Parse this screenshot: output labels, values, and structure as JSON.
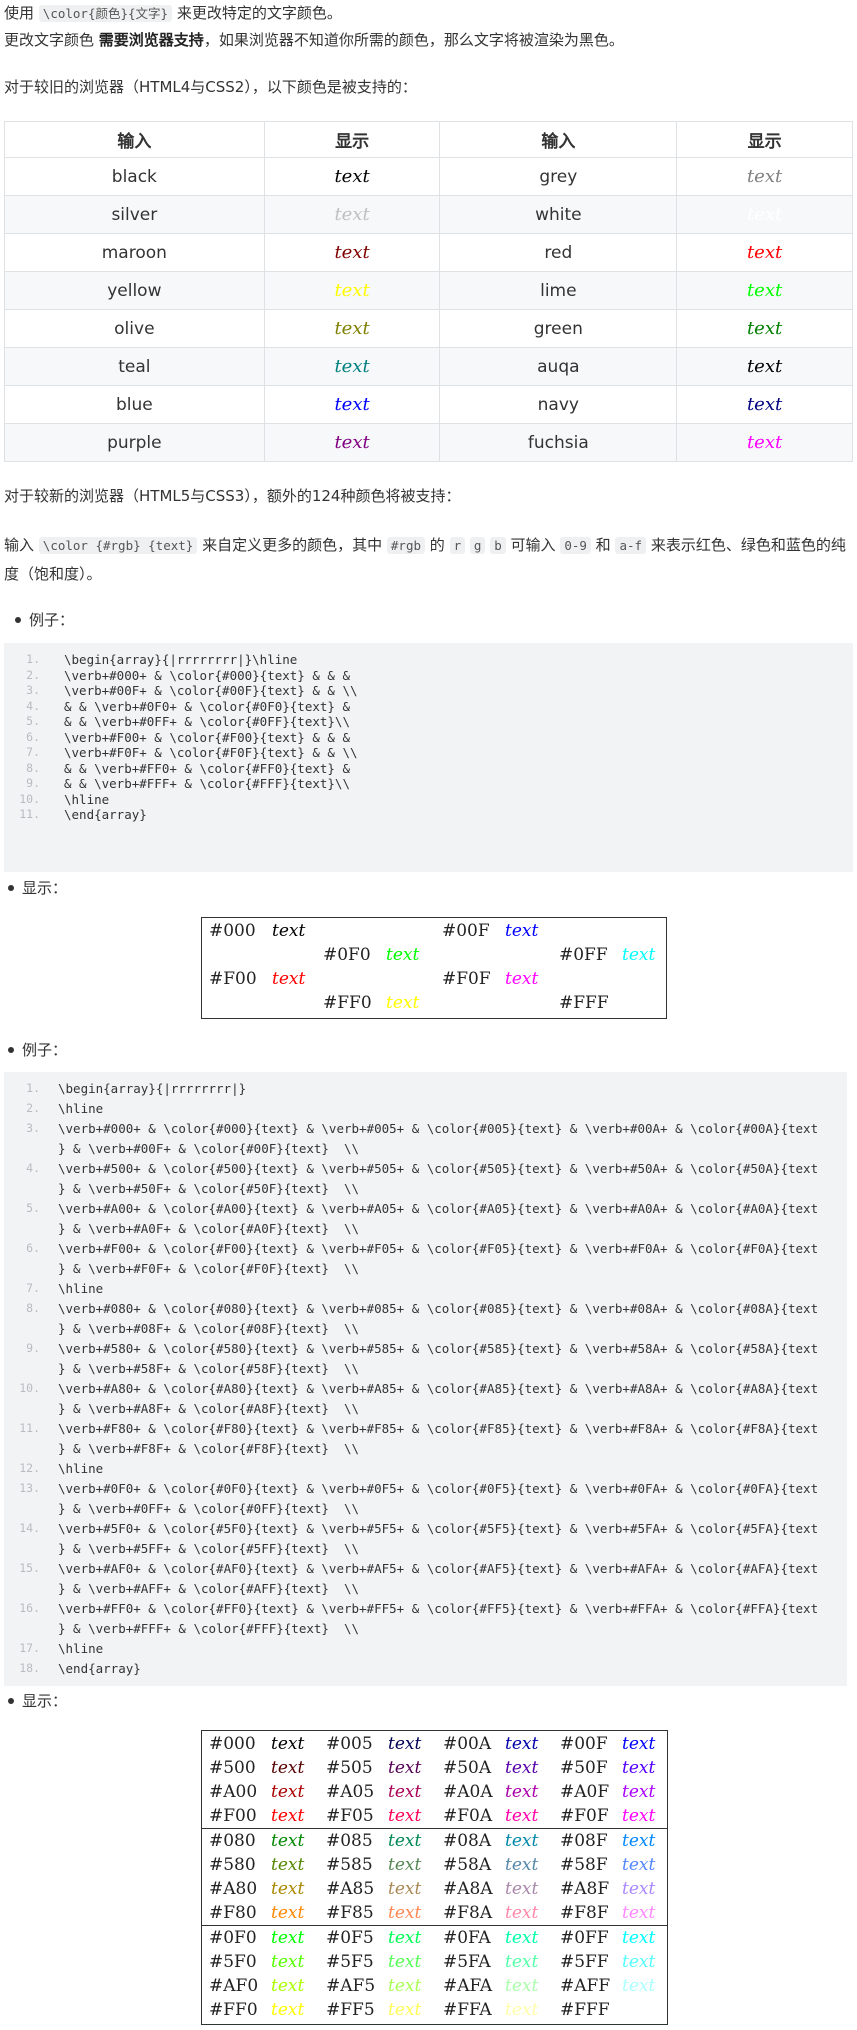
{
  "intro": {
    "line1_pre": "使用",
    "line1_code": "\\color{颜色}{文字}",
    "line1_post": "来更改特定的文字颜色。",
    "line2_pre": "更改文字颜色",
    "line2_bold": "需要浏览器支持",
    "line2_post": "，如果浏览器不知道你所需的颜色，那么文字将被渲染为黑色。",
    "line3": "对于较旧的浏览器（HTML4与CSS2），以下颜色是被支持的："
  },
  "color_table": {
    "headers": [
      "输入",
      "显示",
      "输入",
      "显示"
    ],
    "sample_text": "text",
    "rows": [
      [
        {
          "name": "black",
          "color": "#000000"
        },
        {
          "name": "grey",
          "color": "#808080"
        }
      ],
      [
        {
          "name": "silver",
          "color": "#c0c0c0"
        },
        {
          "name": "white",
          "color": "#ffffff"
        }
      ],
      [
        {
          "name": "maroon",
          "color": "#800000"
        },
        {
          "name": "red",
          "color": "#ff0000"
        }
      ],
      [
        {
          "name": "yellow",
          "color": "#ffff00"
        },
        {
          "name": "lime",
          "color": "#00ff00"
        }
      ],
      [
        {
          "name": "olive",
          "color": "#808000"
        },
        {
          "name": "green",
          "color": "#008000"
        }
      ],
      [
        {
          "name": "teal",
          "color": "#008080"
        },
        {
          "name": "auqa",
          "color": "#000000"
        }
      ],
      [
        {
          "name": "blue",
          "color": "#0000ff"
        },
        {
          "name": "navy",
          "color": "#000080"
        }
      ],
      [
        {
          "name": "purple",
          "color": "#800080"
        },
        {
          "name": "fuchsia",
          "color": "#ff00ff"
        }
      ]
    ]
  },
  "newer": {
    "line1": "对于较新的浏览器（HTML5与CSS3），额外的124种颜色将被支持：",
    "line2_pre": "输入",
    "line2_code1": "\\color {#rgb} {text}",
    "line2_mid1": "来自定义更多的颜色，其中",
    "line2_code2": "#rgb",
    "line2_mid2": "的",
    "code_r": "r",
    "code_g": "g",
    "code_b": "b",
    "line2_mid3": "可输入",
    "code_09": "0-9",
    "line2_and": "和",
    "code_af": "a-f",
    "line2_post": "来表示红色、绿色和蓝色的纯度（饱和度）。"
  },
  "bullets": {
    "example1": "例子：",
    "display1": "显示：",
    "example2": "例子：",
    "display2": "显示："
  },
  "code1": {
    "line_numbers": [
      "1.",
      "2.",
      "3.",
      "4.",
      "5.",
      "6.",
      "7.",
      "8.",
      "9.",
      "10.",
      "11."
    ],
    "lines": [
      "\\begin{array}{|rrrrrrrr|}\\hline",
      "\\verb+#000+ & \\color{#000}{text} & & &",
      "\\verb+#00F+ & \\color{#00F}{text} & & \\\\",
      "& & \\verb+#0F0+ & \\color{#0F0}{text} &",
      "& & \\verb+#0FF+ & \\color{#0FF}{text}\\\\",
      "\\verb+#F00+ & \\color{#F00}{text} & & &",
      "\\verb+#F0F+ & \\color{#F0F}{text} & & \\\\",
      "& & \\verb+#FF0+ & \\color{#FF0}{text} &",
      "& & \\verb+#FFF+ & \\color{#FFF}{text}\\\\",
      "\\hline",
      "\\end{array}"
    ]
  },
  "array1": {
    "sample_text": "text",
    "entries": [
      {
        "code": "#000",
        "color": "#000000",
        "row": 0,
        "col": 0
      },
      {
        "code": "#00F",
        "color": "#0000ff",
        "row": 0,
        "col": 2
      },
      {
        "code": "#0F0",
        "color": "#00ff00",
        "row": 1,
        "col": 1
      },
      {
        "code": "#0FF",
        "color": "#00ffff",
        "row": 1,
        "col": 3
      },
      {
        "code": "#F00",
        "color": "#ff0000",
        "row": 2,
        "col": 0
      },
      {
        "code": "#F0F",
        "color": "#ff00ff",
        "row": 2,
        "col": 2
      },
      {
        "code": "#FF0",
        "color": "#ffff00",
        "row": 3,
        "col": 1
      },
      {
        "code": "#FFF",
        "color": "#ffffff",
        "row": 3,
        "col": 3
      }
    ]
  },
  "code2": {
    "line_numbers": [
      "1.",
      "2.",
      "3.",
      "4.",
      "5.",
      "6.",
      "7.",
      "8.",
      "9.",
      "10.",
      "11.",
      "12.",
      "13.",
      "14.",
      "15.",
      "16.",
      "17.",
      "18."
    ],
    "lines": [
      [
        "\\begin{array}{|rrrrrrrr|}"
      ],
      [
        "\\hline"
      ],
      [
        "\\verb+#000+ & \\color{#000}{text} & \\verb+#005+ & \\color{#005}{text} & \\verb+#00A+ & \\color{#00A}{text",
        "} & \\verb+#00F+ & \\color{#00F}{text}  \\\\"
      ],
      [
        "\\verb+#500+ & \\color{#500}{text} & \\verb+#505+ & \\color{#505}{text} & \\verb+#50A+ & \\color{#50A}{text",
        "} & \\verb+#50F+ & \\color{#50F}{text}  \\\\"
      ],
      [
        "\\verb+#A00+ & \\color{#A00}{text} & \\verb+#A05+ & \\color{#A05}{text} & \\verb+#A0A+ & \\color{#A0A}{text",
        "} & \\verb+#A0F+ & \\color{#A0F}{text}  \\\\"
      ],
      [
        "\\verb+#F00+ & \\color{#F00}{text} & \\verb+#F05+ & \\color{#F05}{text} & \\verb+#F0A+ & \\color{#F0A}{text",
        "} & \\verb+#F0F+ & \\color{#F0F}{text}  \\\\"
      ],
      [
        "\\hline"
      ],
      [
        "\\verb+#080+ & \\color{#080}{text} & \\verb+#085+ & \\color{#085}{text} & \\verb+#08A+ & \\color{#08A}{text",
        "} & \\verb+#08F+ & \\color{#08F}{text}  \\\\"
      ],
      [
        "\\verb+#580+ & \\color{#580}{text} & \\verb+#585+ & \\color{#585}{text} & \\verb+#58A+ & \\color{#58A}{text",
        "} & \\verb+#58F+ & \\color{#58F}{text}  \\\\"
      ],
      [
        "\\verb+#A80+ & \\color{#A80}{text} & \\verb+#A85+ & \\color{#A85}{text} & \\verb+#A8A+ & \\color{#A8A}{text",
        "} & \\verb+#A8F+ & \\color{#A8F}{text}  \\\\"
      ],
      [
        "\\verb+#F80+ & \\color{#F80}{text} & \\verb+#F85+ & \\color{#F85}{text} & \\verb+#F8A+ & \\color{#F8A}{text",
        "} & \\verb+#F8F+ & \\color{#F8F}{text}  \\\\"
      ],
      [
        "\\hline"
      ],
      [
        "\\verb+#0F0+ & \\color{#0F0}{text} & \\verb+#0F5+ & \\color{#0F5}{text} & \\verb+#0FA+ & \\color{#0FA}{text",
        "} & \\verb+#0FF+ & \\color{#0FF}{text}  \\\\"
      ],
      [
        "\\verb+#5F0+ & \\color{#5F0}{text} & \\verb+#5F5+ & \\color{#5F5}{text} & \\verb+#5FA+ & \\color{#5FA}{text",
        "} & \\verb+#5FF+ & \\color{#5FF}{text}  \\\\"
      ],
      [
        "\\verb+#AF0+ & \\color{#AF0}{text} & \\verb+#AF5+ & \\color{#AF5}{text} & \\verb+#AFA+ & \\color{#AFA}{text",
        "} & \\verb+#AFF+ & \\color{#AFF}{text}  \\\\"
      ],
      [
        "\\verb+#FF0+ & \\color{#FF0}{text} & \\verb+#FF5+ & \\color{#FF5}{text} & \\verb+#FFA+ & \\color{#FFA}{text",
        "} & \\verb+#FFF+ & \\color{#FFF}{text}  \\\\"
      ],
      [
        "\\hline"
      ],
      [
        "\\end{array}"
      ]
    ]
  },
  "array2": {
    "sample_text": "text",
    "groups": [
      [
        [
          [
            "#000",
            "#000000"
          ],
          [
            "#005",
            "#000055"
          ],
          [
            "#00A",
            "#0000aa"
          ],
          [
            "#00F",
            "#0000ff"
          ]
        ],
        [
          [
            "#500",
            "#550000"
          ],
          [
            "#505",
            "#550055"
          ],
          [
            "#50A",
            "#5500aa"
          ],
          [
            "#50F",
            "#5500ff"
          ]
        ],
        [
          [
            "#A00",
            "#aa0000"
          ],
          [
            "#A05",
            "#aa0055"
          ],
          [
            "#A0A",
            "#aa00aa"
          ],
          [
            "#A0F",
            "#aa00ff"
          ]
        ],
        [
          [
            "#F00",
            "#ff0000"
          ],
          [
            "#F05",
            "#ff0055"
          ],
          [
            "#F0A",
            "#ff00aa"
          ],
          [
            "#F0F",
            "#ff00ff"
          ]
        ]
      ],
      [
        [
          [
            "#080",
            "#008800"
          ],
          [
            "#085",
            "#008855"
          ],
          [
            "#08A",
            "#0088aa"
          ],
          [
            "#08F",
            "#0088ff"
          ]
        ],
        [
          [
            "#580",
            "#558800"
          ],
          [
            "#585",
            "#558855"
          ],
          [
            "#58A",
            "#5588aa"
          ],
          [
            "#58F",
            "#5588ff"
          ]
        ],
        [
          [
            "#A80",
            "#aa8800"
          ],
          [
            "#A85",
            "#aa8855"
          ],
          [
            "#A8A",
            "#aa88aa"
          ],
          [
            "#A8F",
            "#aa88ff"
          ]
        ],
        [
          [
            "#F80",
            "#ff8800"
          ],
          [
            "#F85",
            "#ff8855"
          ],
          [
            "#F8A",
            "#ff88aa"
          ],
          [
            "#F8F",
            "#ff88ff"
          ]
        ]
      ],
      [
        [
          [
            "#0F0",
            "#00ff00"
          ],
          [
            "#0F5",
            "#00ff55"
          ],
          [
            "#0FA",
            "#00ffaa"
          ],
          [
            "#0FF",
            "#00ffff"
          ]
        ],
        [
          [
            "#5F0",
            "#55ff00"
          ],
          [
            "#5F5",
            "#55ff55"
          ],
          [
            "#5FA",
            "#55ffaa"
          ],
          [
            "#5FF",
            "#55ffff"
          ]
        ],
        [
          [
            "#AF0",
            "#aaff00"
          ],
          [
            "#AF5",
            "#aaff55"
          ],
          [
            "#AFA",
            "#aaffaa"
          ],
          [
            "#AFF",
            "#aaffff"
          ]
        ],
        [
          [
            "#FF0",
            "#ffff00"
          ],
          [
            "#FF5",
            "#ffff55"
          ],
          [
            "#FFA",
            "#ffffaa"
          ],
          [
            "#FFF",
            "#ffffff"
          ]
        ]
      ]
    ]
  }
}
